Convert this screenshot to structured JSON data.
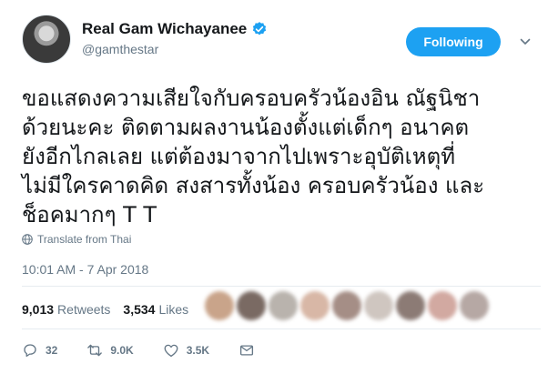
{
  "profile": {
    "display_name": "Real Gam Wichayanee",
    "handle": "@gamthestar",
    "follow_label": "Following"
  },
  "tweet": {
    "text": "ขอแสดงความเสียใจกับครอบครัวน้องอิน ณัฐนิชา\nด้วยนะคะ ติดตามผลงานน้องตั้งแต่เด็กๆ อนาคต\nยังอีกไกลเลย แต่ต้องมาจากไปเพราะอุบัติเหตุที่\nไม่มีใครคาดคิด สงสารทั้งน้อง ครอบครัวน้อง และ\nช็อคมากๆ T T",
    "translate_label": "Translate from Thai",
    "timestamp": "10:01 AM - 7 Apr 2018"
  },
  "stats": {
    "retweets_count": "9,013",
    "retweets_label": "Retweets",
    "likes_count": "3,534",
    "likes_label": "Likes"
  },
  "actions": {
    "reply_count": "32",
    "retweet_count": "9.0K",
    "like_count": "3.5K"
  },
  "icons": {
    "verified": "verified-badge-icon",
    "caret": "chevron-down-icon",
    "translate": "globe-icon",
    "reply": "reply-icon",
    "retweet": "retweet-icon",
    "like": "heart-icon",
    "message": "direct-message-icon"
  },
  "colors": {
    "accent": "#1da1f2",
    "text": "#14171a",
    "muted": "#657786"
  }
}
